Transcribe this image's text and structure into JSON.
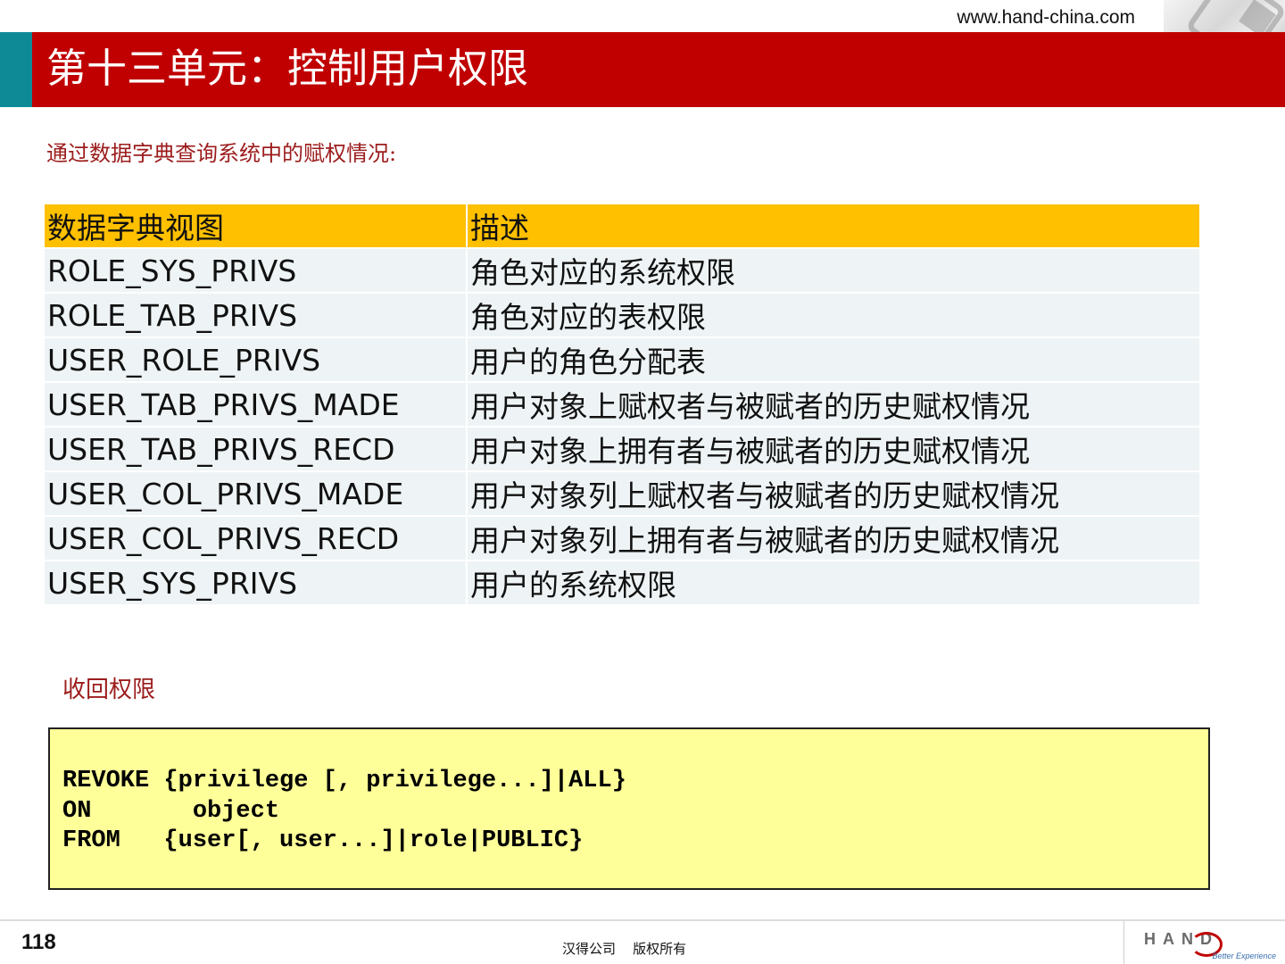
{
  "header": {
    "url": "www.hand-china.com",
    "title": "第十三单元：控制用户权限"
  },
  "intro": "通过数据字典查询系统中的赋权情况:",
  "table": {
    "headers": [
      "数据字典视图",
      "描述"
    ],
    "rows": [
      [
        "ROLE_SYS_PRIVS",
        "角色对应的系统权限"
      ],
      [
        "ROLE_TAB_PRIVS",
        "角色对应的表权限"
      ],
      [
        "USER_ROLE_PRIVS",
        "用户的角色分配表"
      ],
      [
        "USER_TAB_PRIVS_MADE",
        "用户对象上赋权者与被赋者的历史赋权情况"
      ],
      [
        "USER_TAB_PRIVS_RECD",
        "用户对象上拥有者与被赋者的历史赋权情况"
      ],
      [
        "USER_COL_PRIVS_MADE",
        "用户对象列上赋权者与被赋者的历史赋权情况"
      ],
      [
        "USER_COL_PRIVS_RECD",
        "用户对象列上拥有者与被赋者的历史赋权情况"
      ],
      [
        "USER_SYS_PRIVS",
        "用户的系统权限"
      ]
    ]
  },
  "revoke_section": {
    "label": "收回权限",
    "code": "REVOKE {privilege [, privilege...]|ALL}\nON       object\nFROM   {user[, user...]|role|PUBLIC}"
  },
  "footer": {
    "page_number": "118",
    "copyright": "汉得公司    版权所有",
    "logo_text": "HAND",
    "logo_tagline": "Better Experience"
  },
  "colors": {
    "title_band": "#c00000",
    "accent_teal": "#0e8a96",
    "table_header": "#ffc000",
    "table_row": "#eef4f5",
    "code_box": "#ffff99",
    "section_text": "#9c1c1c"
  }
}
